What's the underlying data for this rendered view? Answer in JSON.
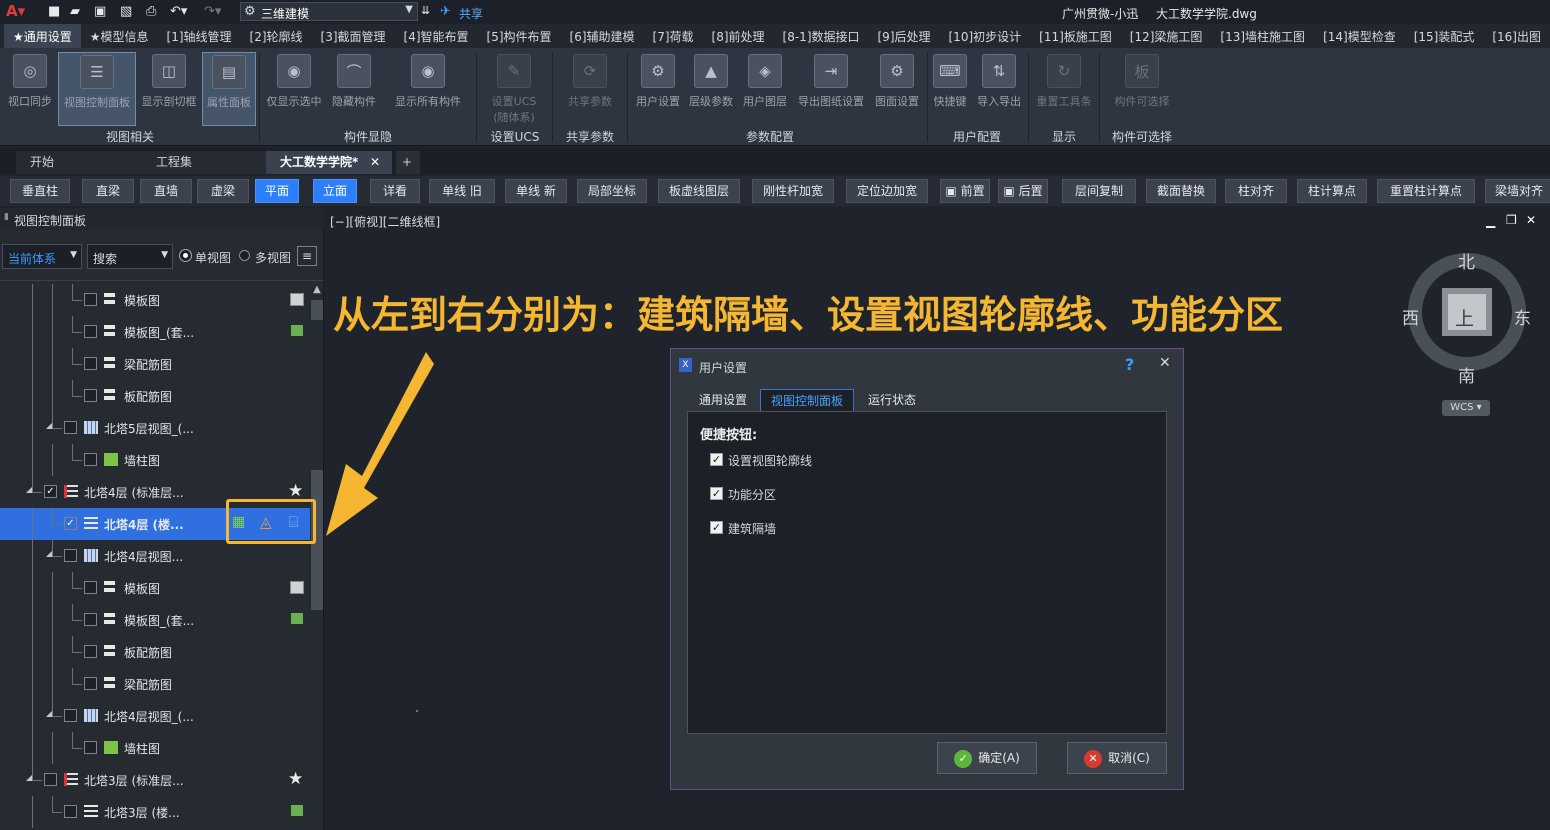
{
  "titlebar": {
    "search_value": "三维建模",
    "share_label": "共享",
    "user": "广州贯微-小迅",
    "file": "大工数学学院.dwg"
  },
  "ribbon_tabs": [
    "★通用设置",
    "★模型信息",
    "[1]轴线管理",
    "[2]轮廓线",
    "[3]截面管理",
    "[4]智能布置",
    "[5]构件布置",
    "[6]辅助建模",
    "[7]荷载",
    "[8]前处理",
    "[8-1]数据接口",
    "[9]后处理",
    "[10]初步设计",
    "[11]板施工图",
    "[12]梁施工图",
    "[13]墙柱施工图",
    "[14]模型检查",
    "[15]装配式",
    "[16]出图"
  ],
  "ribbon": {
    "buttons": [
      "视口同步",
      "视图控制面板",
      "显示剖切框",
      "属性面板",
      "仅显示选中",
      "隐藏构件",
      "显示所有构件",
      "设置UCS",
      "(随体系)",
      "共享参数",
      "用户设置",
      "层级参数",
      "用户图层",
      "导出图纸设置",
      "图面设置",
      "快捷键",
      "导入导出",
      "重置工具条",
      "构件可选择"
    ],
    "groups": [
      "视图相关",
      "构件显隐",
      "设置UCS",
      "共享参数",
      "参数配置",
      "用户配置",
      "显示",
      "构件可选择"
    ]
  },
  "doc_tabs": [
    "开始",
    "工程集",
    "大工数学学院*"
  ],
  "commands": [
    "垂直柱",
    "直梁",
    "直墙",
    "虚梁",
    "平面",
    "立面",
    "详看",
    "单线 旧",
    "单线 新",
    "局部坐标",
    "板虚线图层",
    "刚性杆加宽",
    "定位边加宽",
    "前置",
    "后置",
    "层间复制",
    "截面替换",
    "柱对齐",
    "柱计算点",
    "重置柱计算点",
    "梁墙对齐"
  ],
  "panel": {
    "title": "视图控制面板",
    "system_select": "当前体系",
    "search_select": "搜索",
    "radio_single": "单视图",
    "radio_multi": "多视图",
    "tree": [
      "模板图",
      "模板图_(套...",
      "梁配筋图",
      "板配筋图",
      "北塔5层视图_(...",
      "墙柱图",
      "北塔4层  (标准层...",
      "北塔4层  (楼...",
      "北塔4层视图...",
      "模板图",
      "模板图_(套...",
      "板配筋图",
      "梁配筋图",
      "北塔4层视图_(...",
      "墙柱图",
      "北塔3层  (标准层...",
      "北塔3层  (楼..."
    ]
  },
  "viewport": {
    "label": "[−][俯视][二维线框]",
    "annotation": "从左到右分别为：建筑隔墙、设置视图轮廓线、功能分区"
  },
  "viewcube": {
    "north": "北",
    "south": "南",
    "east": "东",
    "west": "西",
    "top": "上",
    "wcs": "WCS"
  },
  "dialog": {
    "title": "用户设置",
    "help": "?",
    "tabs": [
      "通用设置",
      "视图控制面板",
      "运行状态"
    ],
    "section": "便捷按钮:",
    "options": [
      "设置视图轮廓线",
      "功能分区",
      "建筑隔墙"
    ],
    "ok": "确定(A)",
    "cancel": "取消(C)"
  },
  "colors": {
    "accent": "#2d7ff9",
    "highlight": "#f5b731"
  }
}
